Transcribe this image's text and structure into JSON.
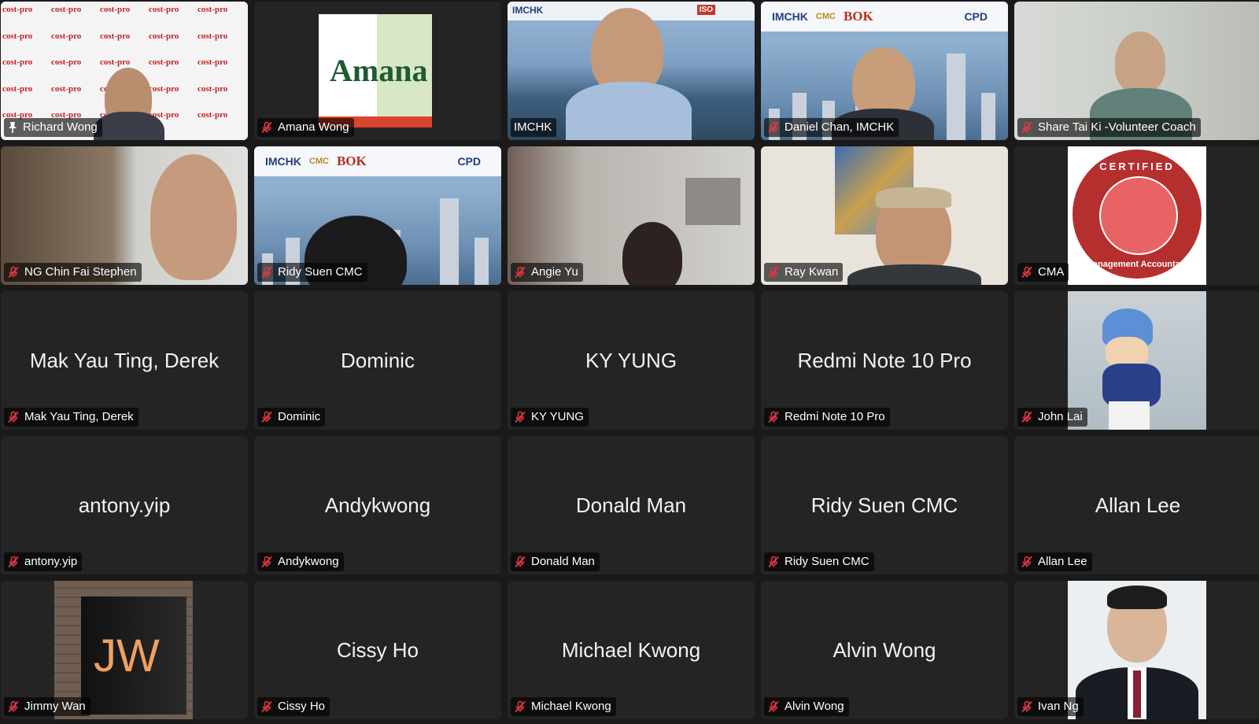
{
  "participants": [
    {
      "tile_name": "Richard Wong",
      "label": "Richard Wong",
      "video": "cost-pro",
      "active": true,
      "pinned": true
    },
    {
      "tile_name": "Amana Wong",
      "label": "Amana Wong",
      "video": "amana-logo"
    },
    {
      "tile_name": "IMCHK",
      "label": "IMCHK",
      "video": "speaker-harbour",
      "no_mute": true
    },
    {
      "tile_name": "Daniel Chan, IMCHK",
      "label": "Daniel Chan, IMCHK",
      "video": "bok-banner-person"
    },
    {
      "tile_name": "Share Tai Ki -Volunteer Coach",
      "label": "Share Tai Ki -Volunteer Coach",
      "video": "person-room"
    },
    {
      "tile_name": "NG Chin Fai Stephen",
      "label": "NG Chin Fai Stephen",
      "video": "person-shelf"
    },
    {
      "tile_name": "Ridy Suen CMC",
      "label": "Ridy Suen CMC",
      "video": "bok-banner-back"
    },
    {
      "tile_name": "Angie Yu",
      "label": "Angie Yu",
      "video": "person-home"
    },
    {
      "tile_name": "Ray Kwan",
      "label": "Ray Kwan",
      "video": "person-cap"
    },
    {
      "tile_name": "CMA",
      "label": "CMA",
      "video": "certified-seal"
    },
    {
      "tile_name": "Mak Yau Ting, Derek",
      "label": "Mak Yau Ting, Derek",
      "center": "Mak Yau Ting, Derek"
    },
    {
      "tile_name": "Dominic",
      "label": "Dominic",
      "center": "Dominic"
    },
    {
      "tile_name": "KY YUNG",
      "label": "KY YUNG",
      "center": "KY YUNG"
    },
    {
      "tile_name": "Redmi Note 10 Pro",
      "label": "Redmi Note 10 Pro",
      "center": "Redmi Note 10 Pro"
    },
    {
      "tile_name": "John Lai",
      "label": "John Lai",
      "video": "golfer-cartoon"
    },
    {
      "tile_name": "antony.yip",
      "label": "antony.yip",
      "center": "antony.yip"
    },
    {
      "tile_name": "Andykwong",
      "label": "Andykwong",
      "center": "Andykwong"
    },
    {
      "tile_name": "Donald Man",
      "label": "Donald Man",
      "center": "Donald Man"
    },
    {
      "tile_name": "Ridy Suen CMC",
      "label": "Ridy Suen CMC",
      "center": "Ridy Suen CMC"
    },
    {
      "tile_name": "Allan Lee",
      "label": "Allan Lee",
      "center": "Allan Lee"
    },
    {
      "tile_name": "Jimmy Wan",
      "label": "Jimmy Wan",
      "video": "jw-sign"
    },
    {
      "tile_name": "Cissy Ho",
      "label": "Cissy Ho",
      "center": "Cissy Ho"
    },
    {
      "tile_name": "Michael Kwong",
      "label": "Michael Kwong",
      "center": "Michael Kwong"
    },
    {
      "tile_name": "Alvin Wong",
      "label": "Alvin Wong",
      "center": "Alvin Wong"
    },
    {
      "tile_name": "Ivan Ng",
      "label": "Ivan Ng",
      "video": "portrait-suit"
    }
  ],
  "branding": {
    "cost_pro_text": "cost-pro",
    "amana_text": "Amana",
    "imchk_text": "IMCHK",
    "bok_text": "BOK",
    "cpd_text": "CPD",
    "cmc_text": "CMC",
    "iso_text": "ISO",
    "certified_text": "CERTIFIED",
    "management_accountant_text": "Management Accountant",
    "jw_text": "JW"
  },
  "colors": {
    "active_speaker_border": "#35c36c",
    "muted_icon": "#e0393e",
    "tile_bg": "#242424",
    "page_bg": "#1a1a1a"
  },
  "icons": {
    "muted": "microphone-muted-icon",
    "pin": "pin-icon"
  }
}
